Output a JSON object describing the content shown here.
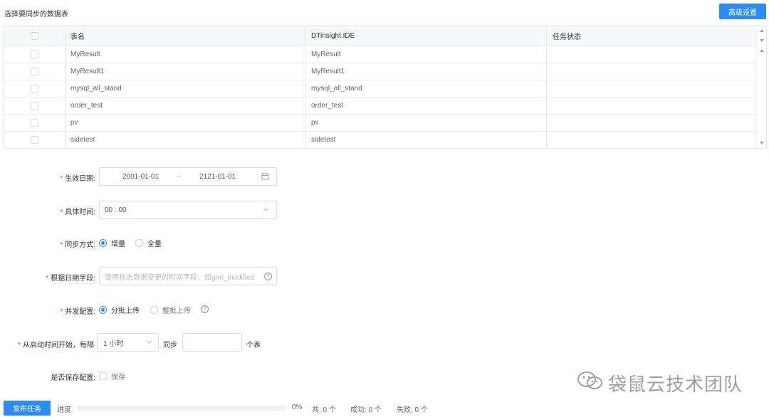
{
  "header": {
    "title": "选择要同步的数据表",
    "advanced_button": "高级设置"
  },
  "table": {
    "columns": [
      "表名",
      "DTinsight.IDE",
      "任务状态"
    ],
    "rows": [
      {
        "name": "MyResult",
        "ide": "MyResult",
        "status": ""
      },
      {
        "name": "MyResult1",
        "ide": "MyResult1",
        "status": ""
      },
      {
        "name": "mysql_all_stand",
        "ide": "mysql_all_stand",
        "status": ""
      },
      {
        "name": "order_test",
        "ide": "order_test",
        "status": ""
      },
      {
        "name": "pv",
        "ide": "pv",
        "status": ""
      },
      {
        "name": "sidetest",
        "ide": "sidetest",
        "status": ""
      }
    ]
  },
  "form": {
    "effective_date": {
      "label": "生效日期:",
      "start": "2001-01-01",
      "separator": "~",
      "end": "2121-01-01"
    },
    "specific_time": {
      "label": "具体时间:",
      "value": "00 : 00"
    },
    "sync_mode": {
      "label": "同步方式:",
      "options": [
        "增量",
        "全量"
      ],
      "selected": "增量"
    },
    "date_field": {
      "label": "根据日期字段:",
      "placeholder": "使用标志数据变更的时间字段，如gmt_modified"
    },
    "concurrency": {
      "label": "并发配置:",
      "options": [
        "分批上传",
        "整批上传"
      ],
      "selected": "分批上传"
    },
    "schedule": {
      "label": "从启动时间开始，每隔",
      "interval": "1 小时",
      "sync_word": "同步",
      "count": "",
      "suffix": "个表"
    },
    "save_config": {
      "label": "是否保存配置:",
      "checkbox_label": "保存"
    }
  },
  "footer": {
    "publish_button": "发布任务",
    "progress_label": "进度",
    "progress_value": 0,
    "progress_text": "0%",
    "total": "共: 0 个",
    "success": "成功: 0 个",
    "failed": "失败: 0 个"
  },
  "watermark": {
    "text": "袋鼠云技术团队"
  },
  "colors": {
    "primary": "#2d8cf0",
    "required": "#f04134",
    "border": "#d9dde3"
  }
}
